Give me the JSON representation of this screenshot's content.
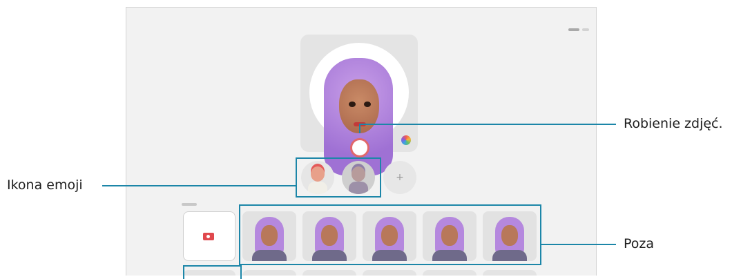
{
  "callouts": {
    "capture": "Robienie zdjęć.",
    "emoji_icon": "Ikona emoji",
    "pose": "Poza"
  },
  "controls": {
    "add_emoji_symbol": "+"
  },
  "colors": {
    "callout_line": "#1c86a8",
    "shutter_ring": "#e1676b",
    "avatar_hair": "#b588de",
    "camera_icon": "#e0484d"
  },
  "icons": {
    "shutter": "shutter-button",
    "color_picker": "color-wheel-icon",
    "camera": "camera-icon",
    "add": "plus-icon"
  }
}
